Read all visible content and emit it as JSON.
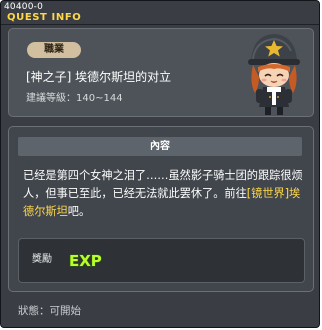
{
  "window": {
    "quest_id": "40400-0",
    "title": "QUEST INFO"
  },
  "header": {
    "job_badge": "職業",
    "quest_name": "[神之子] 埃德尔斯坦的对立",
    "level_label": "建議等級：",
    "level_range": "140~144",
    "npc_icon": "npc-helmet-girl-portrait"
  },
  "content": {
    "section_title": "內容",
    "description_part1": "已经是第四个女神之泪了……虽然影子骑士团的跟踪很烦人，但事已至此，已经无法就此罢休了。前往",
    "description_highlight": "[镜世界]埃德尔斯坦",
    "description_part2": "吧。",
    "reward_label": "獎勵",
    "reward_icon": "exp-icon",
    "reward_icon_text": "EXP"
  },
  "footer": {
    "status_label": "狀態：",
    "status_value": "可開始"
  },
  "colors": {
    "window_bg": "#3a3e44",
    "title_yellow": "#ffd84a",
    "highlight_yellow": "#ffd84a",
    "badge_bg": "#d2bf9f",
    "exp_green": "#b8ff2a"
  }
}
